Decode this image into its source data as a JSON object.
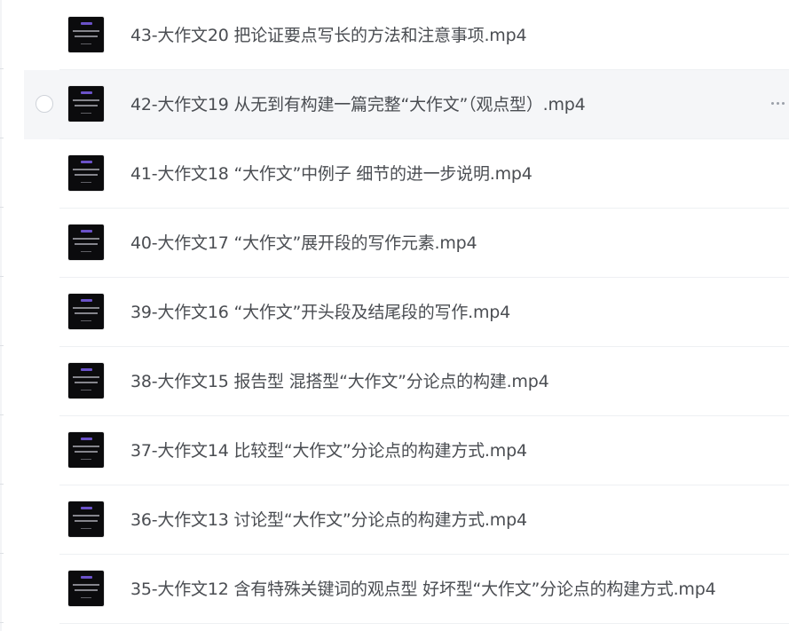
{
  "files": [
    {
      "name": "43-大作文20 把论证要点写长的方法和注意事项.mp4",
      "hovered": false
    },
    {
      "name": "42-大作文19 从无到有构建一篇完整“大作文”（观点型）.mp4",
      "hovered": true
    },
    {
      "name": "41-大作文18 “大作文”中例子 细节的进一步说明.mp4",
      "hovered": false
    },
    {
      "name": "40-大作文17 “大作文”展开段的写作元素.mp4",
      "hovered": false
    },
    {
      "name": "39-大作文16 “大作文”开头段及结尾段的写作.mp4",
      "hovered": false
    },
    {
      "name": "38-大作文15 报告型 混搭型“大作文”分论点的构建.mp4",
      "hovered": false
    },
    {
      "name": "37-大作文14 比较型“大作文”分论点的构建方式.mp4",
      "hovered": false
    },
    {
      "name": "36-大作文13 讨论型“大作文”分论点的构建方式.mp4",
      "hovered": false
    },
    {
      "name": "35-大作文12 含有特殊关键词的观点型 好坏型“大作文”分论点的构建方式.mp4",
      "hovered": false
    }
  ],
  "icons": {
    "thumbnail": "video-thumbnail-icon",
    "select": "select-circle-icon",
    "more": "more-options-icon"
  },
  "colors": {
    "text": "#4a4d52",
    "hover_bg": "#f5f6f8",
    "thumbnail_bg": "#0b0b0d",
    "thumbnail_accent": "#6b52c9"
  }
}
